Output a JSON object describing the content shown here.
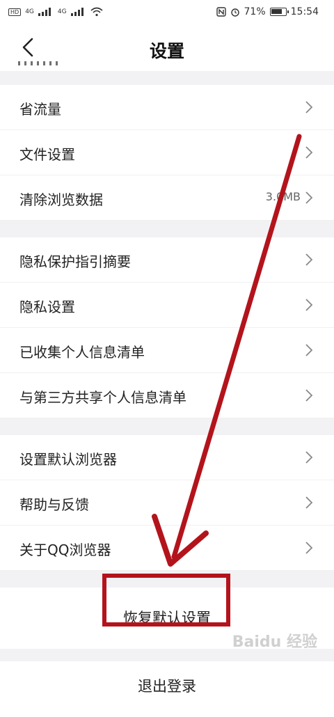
{
  "status_bar": {
    "hd_label": "HD",
    "net1": "4G",
    "net2": "4G",
    "battery_percent": "71%",
    "time": "15:54"
  },
  "header": {
    "title": "设置"
  },
  "groups": [
    {
      "items": [
        {
          "label": "省流量"
        },
        {
          "label": "文件设置"
        },
        {
          "label": "清除浏览数据",
          "value": "3.0MB"
        }
      ]
    },
    {
      "items": [
        {
          "label": "隐私保护指引摘要"
        },
        {
          "label": "隐私设置"
        },
        {
          "label": "已收集个人信息清单"
        },
        {
          "label": "与第三方共享个人信息清单"
        }
      ]
    },
    {
      "items": [
        {
          "label": "设置默认浏览器"
        },
        {
          "label": "帮助与反馈"
        },
        {
          "label": "关于QQ浏览器"
        }
      ]
    }
  ],
  "restore_button": {
    "label": "恢复默认设置"
  },
  "logout_button": {
    "label": "退出登录"
  },
  "annotation": {
    "color": "#b3141c"
  },
  "watermark": {
    "text": "Baidu 经验"
  }
}
